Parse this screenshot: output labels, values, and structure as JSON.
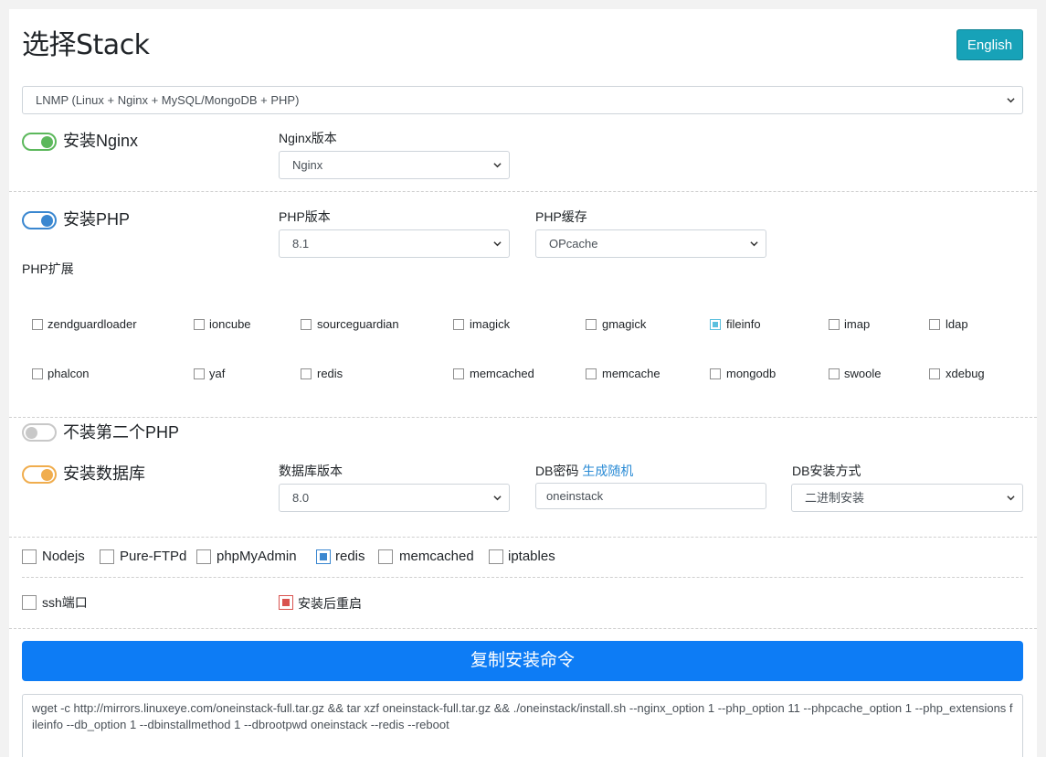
{
  "header": {
    "title": "选择Stack",
    "lang_button": "English"
  },
  "stack_select": {
    "value": "LNMP (Linux + Nginx + MySQL/MongoDB + PHP)"
  },
  "nginx": {
    "toggle_label": "安装Nginx",
    "version_label": "Nginx版本",
    "version_value": "Nginx"
  },
  "php": {
    "toggle_label": "安装PHP",
    "version_label": "PHP版本",
    "version_value": "8.1",
    "cache_label": "PHP缓存",
    "cache_value": "OPcache",
    "ext_label": "PHP扩展",
    "extensions": [
      {
        "name": "zendguardloader",
        "checked": false
      },
      {
        "name": "ioncube",
        "checked": false
      },
      {
        "name": "sourceguardian",
        "checked": false
      },
      {
        "name": "imagick",
        "checked": false
      },
      {
        "name": "gmagick",
        "checked": false
      },
      {
        "name": "fileinfo",
        "checked": true
      },
      {
        "name": "imap",
        "checked": false
      },
      {
        "name": "ldap",
        "checked": false
      },
      {
        "name": "phalcon",
        "checked": false
      },
      {
        "name": "yaf",
        "checked": false
      },
      {
        "name": "redis",
        "checked": false
      },
      {
        "name": "memcached",
        "checked": false
      },
      {
        "name": "memcache",
        "checked": false
      },
      {
        "name": "mongodb",
        "checked": false
      },
      {
        "name": "swoole",
        "checked": false
      },
      {
        "name": "xdebug",
        "checked": false
      }
    ]
  },
  "php2": {
    "toggle_label": "不装第二个PHP"
  },
  "db": {
    "toggle_label": "安装数据库",
    "version_label": "数据库版本",
    "version_value": "8.0",
    "pwd_label": "DB密码",
    "pwd_link": "生成随机",
    "pwd_value": "oneinstack",
    "method_label": "DB安装方式",
    "method_value": "二进制安装"
  },
  "options": [
    {
      "label": "Nodejs",
      "checked": false
    },
    {
      "label": "Pure-FTPd",
      "checked": false
    },
    {
      "label": "phpMyAdmin",
      "checked": false
    },
    {
      "label": "redis",
      "checked": true
    },
    {
      "label": "memcached",
      "checked": false
    },
    {
      "label": "iptables",
      "checked": false
    }
  ],
  "ssh": {
    "label": "ssh端口",
    "checked": false
  },
  "reboot": {
    "label": "安装后重启",
    "checked": true
  },
  "copy_button": "复制安装命令",
  "command": "wget -c http://mirrors.linuxeye.com/oneinstack-full.tar.gz && tar xzf oneinstack-full.tar.gz && ./oneinstack/install.sh --nginx_option 1 --php_option 11 --phpcache_option 1 --php_extensions fileinfo --db_option 1 --dbinstallmethod 1 --dbrootpwd oneinstack --redis  --reboot",
  "colors": {
    "accent": "#0d7cf5",
    "lang_button": "#17a2b8",
    "nginx": "#5cb85c",
    "php": "#3a87d0",
    "db": "#f0ad4e",
    "reboot": "#d9534f",
    "ext_checked": "#5bc0de"
  }
}
